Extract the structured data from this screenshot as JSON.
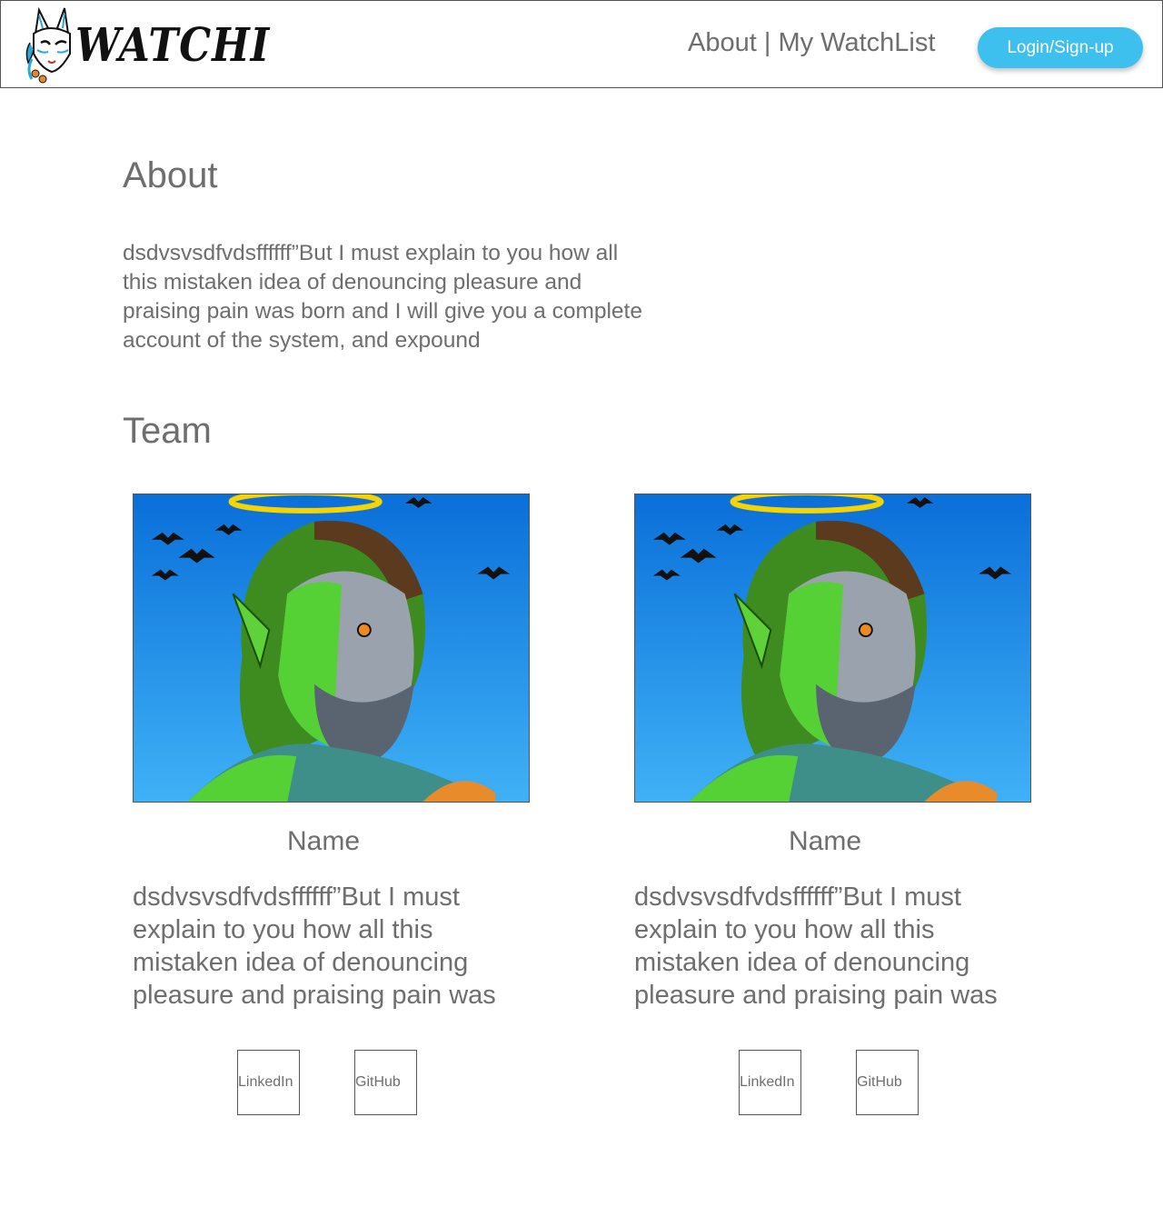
{
  "header": {
    "logo_text": "WATCHI",
    "nav_about": "About",
    "nav_separator": " | ",
    "nav_watchlist": "My WatchList",
    "login_label": "Login/Sign-up",
    "accent_color": "#3dc0ee"
  },
  "about": {
    "title": "About",
    "text": "dsdvsvsdfvdsffffff”But I must explain to you how all this mistaken idea of denouncing pleasure and praising pain was born and I will give you a complete account of the system, and expound"
  },
  "team": {
    "title": "Team",
    "members": [
      {
        "photo_icon": "team-member-portrait",
        "name": "Name",
        "bio": "dsdvsvsdfvdsffffff”But I must explain to you how all this mistaken idea of denouncing pleasure and praising pain was",
        "linkedin_label": "LinkedIn",
        "github_label": "GitHub"
      },
      {
        "photo_icon": "team-member-portrait",
        "name": "Name",
        "bio": "dsdvsvsdfvdsffffff”But I must explain to you how all this mistaken idea of denouncing pleasure and praising pain was",
        "linkedin_label": "LinkedIn",
        "github_label": "GitHub"
      }
    ]
  }
}
